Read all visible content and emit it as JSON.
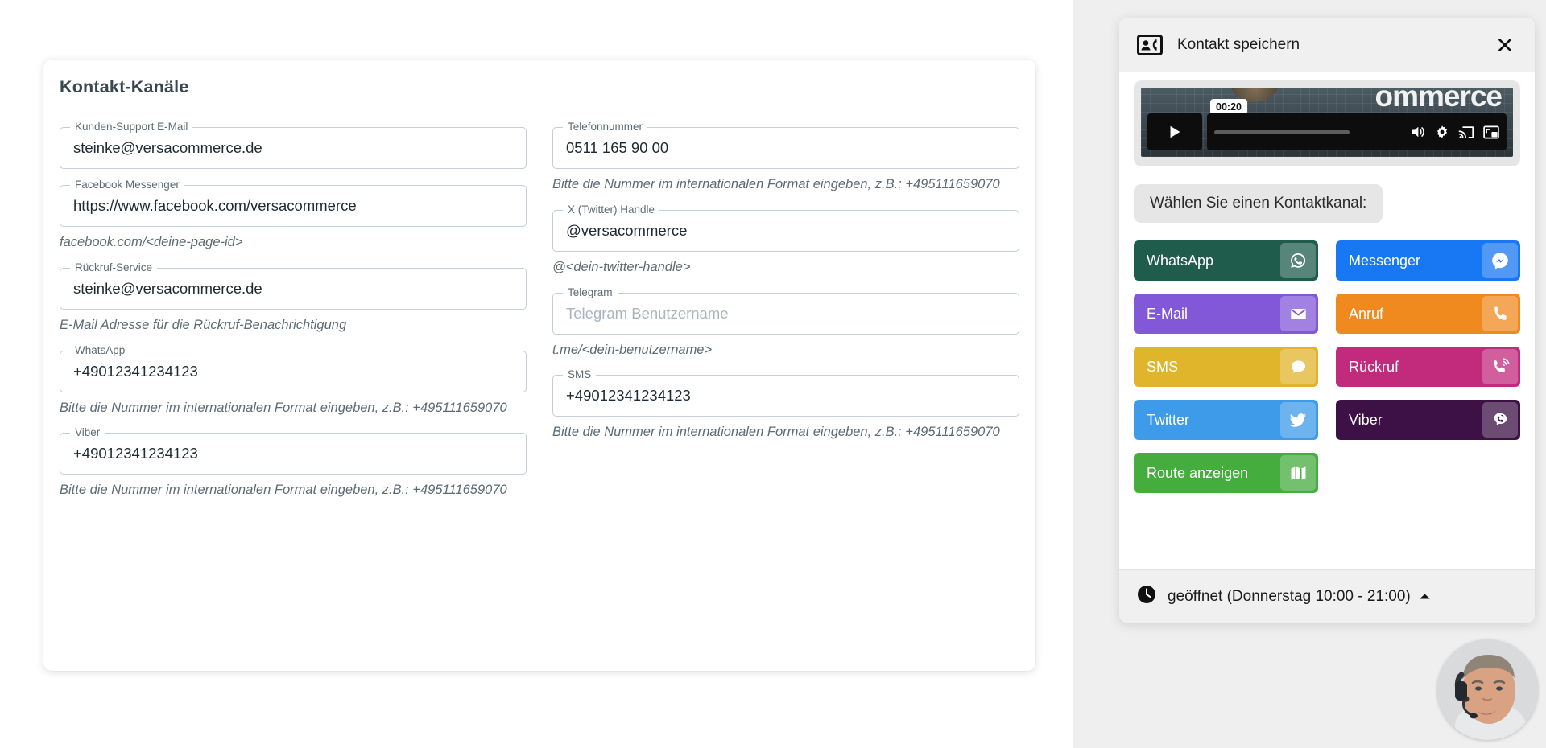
{
  "admin": {
    "card_title": "Kontakt-Kanäle",
    "fields_left": [
      {
        "label": "Kunden-Support E-Mail",
        "value": "steinke@versacommerce.de",
        "placeholder": "",
        "hint": ""
      },
      {
        "label": "Facebook Messenger",
        "value": "https://www.facebook.com/versacommerce",
        "placeholder": "",
        "hint": "facebook.com/<deine-page-id>"
      },
      {
        "label": "Rückruf-Service",
        "value": "steinke@versacommerce.de",
        "placeholder": "",
        "hint": "E-Mail Adresse für die Rückruf-Benachrichtigung"
      },
      {
        "label": "WhatsApp",
        "value": "+49012341234123",
        "placeholder": "",
        "hint": "Bitte die Nummer im internationalen Format eingeben, z.B.: +495111659070"
      },
      {
        "label": "Viber",
        "value": "+49012341234123",
        "placeholder": "",
        "hint": "Bitte die Nummer im internationalen Format eingeben, z.B.: +495111659070"
      }
    ],
    "fields_right": [
      {
        "label": "Telefonnummer",
        "value": "0511 165 90 00",
        "placeholder": "",
        "hint": "Bitte die Nummer im internationalen Format eingeben, z.B.: +495111659070"
      },
      {
        "label": "X (Twitter) Handle",
        "value": "@versacommerce",
        "placeholder": "",
        "hint": "@<dein-twitter-handle>"
      },
      {
        "label": "Telegram",
        "value": "",
        "placeholder": "Telegram Benutzername",
        "hint": "t.me/<dein-benutzername>"
      },
      {
        "label": "SMS",
        "value": "+49012341234123",
        "placeholder": "",
        "hint": "Bitte die Nummer im internationalen Format eingeben, z.B.: +495111659070"
      }
    ]
  },
  "widget": {
    "header": {
      "title": "Kontakt speichern",
      "icon": "contact-card-icon",
      "close_icon": "close-icon"
    },
    "video": {
      "time_tooltip": "00:20",
      "wordmark": "ommerce",
      "play_icon": "play-icon",
      "volume_icon": "volume-icon",
      "settings_icon": "gear-icon",
      "cast_icon": "cast-icon",
      "pip_icon": "picture-in-picture-icon"
    },
    "prompt": "Wählen Sie einen Kontaktkanal:",
    "channels": [
      {
        "label": "WhatsApp",
        "icon": "whatsapp-icon",
        "color": "#1f5c4c"
      },
      {
        "label": "Messenger",
        "icon": "messenger-icon",
        "color": "#1877f2"
      },
      {
        "label": "E-Mail",
        "icon": "envelope-icon",
        "color": "#8257d8"
      },
      {
        "label": "Anruf",
        "icon": "phone-icon",
        "color": "#f08a1e"
      },
      {
        "label": "SMS",
        "icon": "chat-bubble-icon",
        "color": "#e0b52c"
      },
      {
        "label": "Rückruf",
        "icon": "phone-ring-icon",
        "color": "#c22a7c"
      },
      {
        "label": "Twitter",
        "icon": "twitter-icon",
        "color": "#3d9bea"
      },
      {
        "label": "Viber",
        "icon": "viber-icon",
        "color": "#3d1145"
      },
      {
        "label": "Route anzeigen",
        "icon": "map-icon",
        "color": "#44ad3e"
      }
    ],
    "footer": {
      "status": "geöffnet (Donnerstag 10:00 - 21:00)",
      "clock_icon": "clock-icon",
      "caret_icon": "chevron-up-icon"
    }
  },
  "avatar": {
    "name": "support-agent-avatar"
  }
}
